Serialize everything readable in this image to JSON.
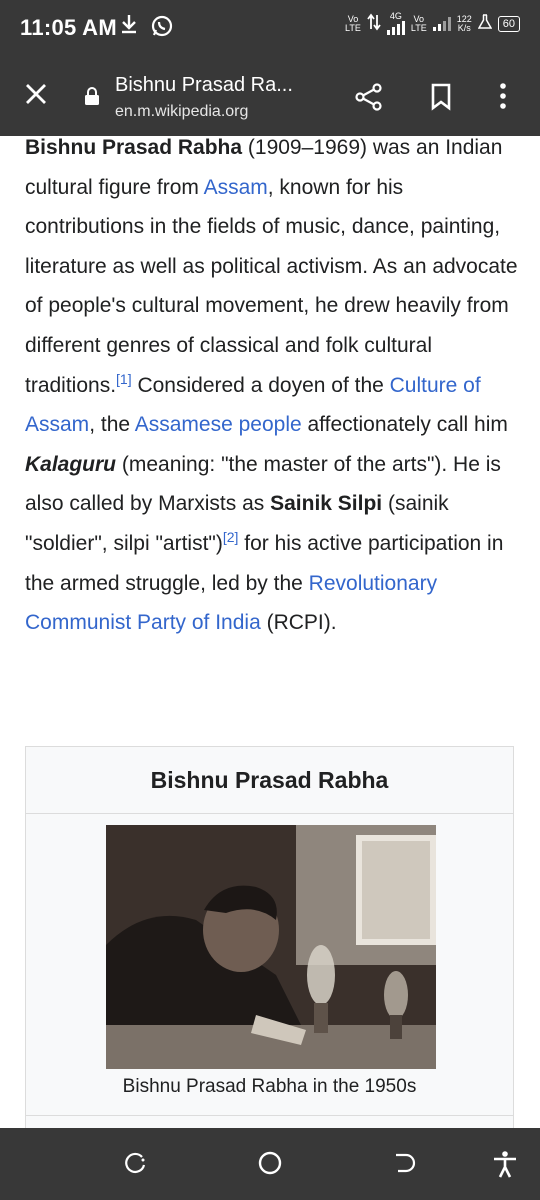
{
  "status_bar": {
    "time": "11:05 AM",
    "net_speed_value": "122",
    "net_speed_unit": "K/s",
    "sim1_top": "Vo",
    "sim1_bottom": "LTE",
    "sim2_top": "Vo",
    "sim2_bottom": "LTE",
    "network_type": "4G",
    "battery": "60",
    "icons": [
      "download-icon",
      "whatsapp-icon",
      "data-arrows-icon",
      "signal-icon",
      "flask-icon",
      "battery-icon"
    ]
  },
  "toolbar": {
    "title": "Bishnu Prasad Ra...",
    "url": "en.m.wikipedia.org",
    "icons": [
      "close-icon",
      "lock-icon",
      "share-icon",
      "bookmark-icon",
      "more-icon"
    ]
  },
  "article": {
    "name_bold": "Bishnu Prasad Rabha",
    "t1": " (1909–1969) was an Indian cultural figure from ",
    "link_assam": "Assam",
    "t2": ", known for his contributions in the fields of music, dance, painting, literature as well as political activism. As an advocate of people's cultural movement, he drew heavily from different genres of classical and folk cultural traditions.",
    "ref1": "[1]",
    "t3": " Considered a doyen of the ",
    "link_culture": "Culture of Assam",
    "t4": ", the ",
    "link_people": "Assamese people",
    "t5": " affectionately call him ",
    "kalaguru": "Kalaguru",
    "t6": " (meaning: \"the master of the arts\"). He is also called by Marxists as ",
    "sainik": "Sainik Silpi",
    "t7": " (sainik \"soldier\", silpi \"artist\")",
    "ref2": "[2]",
    "t8": " for his active participation in the armed struggle, led by the ",
    "link_rcpi": "Revolutionary Communist Party of India",
    "t9": " (RCPI)."
  },
  "infobox": {
    "title": "Bishnu Prasad Rabha",
    "caption": "Bishnu Prasad Rabha in the 1950s"
  },
  "nav_bar": {
    "icons": [
      "recents-icon",
      "home-icon",
      "back-icon",
      "accessibility-icon"
    ]
  },
  "colors": {
    "bar_bg": "#383838",
    "link": "#3366cc",
    "text": "#202122",
    "infobox_bg": "#f8f9fa"
  }
}
